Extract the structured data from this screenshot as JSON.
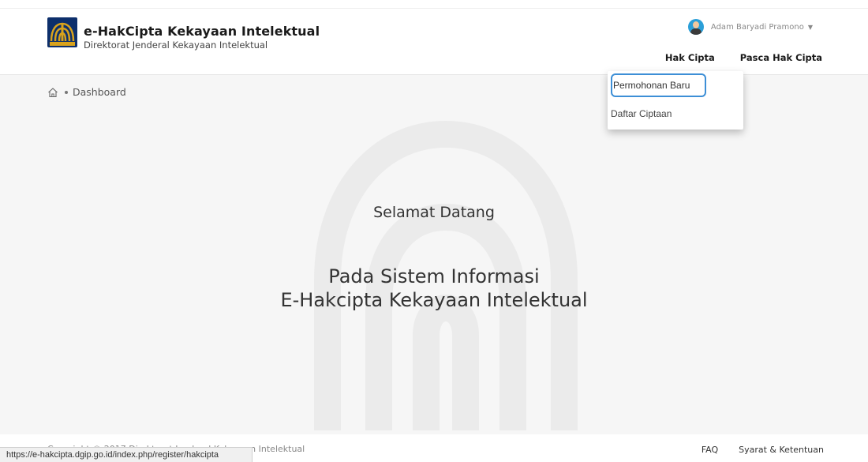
{
  "header": {
    "title": "e-HakCipta Kekayaan Intelektual",
    "subtitle": "Direktorat Jenderal Kekayaan Intelektual",
    "logo_icon": "kemenkumham-logo-icon",
    "user_name": "Adam Baryadi Pramono",
    "nav": {
      "hak_cipta": "Hak Cipta",
      "pasca_hak_cipta": "Pasca Hak Cipta"
    }
  },
  "dropdown": {
    "items": [
      {
        "label": "Permohonan Baru"
      },
      {
        "label": "Daftar Ciptaan"
      }
    ]
  },
  "breadcrumb": {
    "current": "Dashboard",
    "icon": "home-icon"
  },
  "main": {
    "welcome": "Selamat Datang",
    "line1": "Pada Sistem Informasi",
    "line2": "E-Hakcipta Kekayaan Intelektual"
  },
  "footer": {
    "copyright": "Copyright © 2017 Direktorat Jenderal Kekayaan Intelektual",
    "links": {
      "faq": "FAQ",
      "terms": "Syarat & Ketentuan"
    }
  },
  "status_bar": {
    "url": "https://e-hakcipta.dgip.go.id/index.php/register/hakcipta"
  },
  "colors": {
    "logo_bg": "#0d2f6b",
    "logo_gold": "#d8a21c",
    "focus_border": "#3d8fd6"
  }
}
